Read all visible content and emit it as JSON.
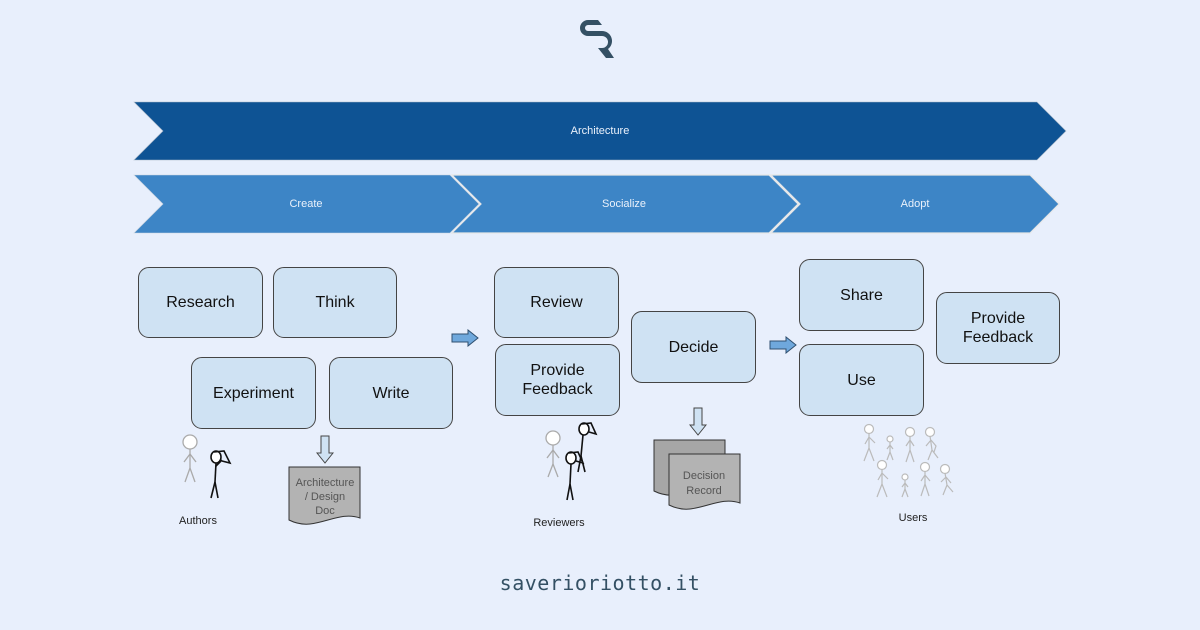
{
  "logo": {
    "icon": "sr-logo-icon",
    "color": "#345064"
  },
  "colors": {
    "background": "#e8effc",
    "architecture_bar": "#0e5394",
    "phase_bar": "#3d85c6",
    "box_fill": "#cfe2f3",
    "document_fill": "#b3b3b3",
    "arrow_fill": "#6fa8dc"
  },
  "architecture": {
    "label": "Architecture"
  },
  "phases": [
    {
      "label": "Create"
    },
    {
      "label": "Socialize"
    },
    {
      "label": "Adopt"
    }
  ],
  "create": {
    "boxes": [
      "Research",
      "Think",
      "Experiment",
      "Write"
    ],
    "actors_label": "Authors",
    "document": {
      "lines": [
        "Architecture",
        "/ Design",
        "Doc"
      ]
    }
  },
  "socialize": {
    "boxes": [
      "Review",
      "Provide\nFeedback",
      "Decide"
    ],
    "actors_label": "Reviewers",
    "document": {
      "lines": [
        "Decision",
        "Record"
      ]
    }
  },
  "adopt": {
    "boxes": [
      "Share",
      "Use",
      "Provide\nFeedback"
    ],
    "actors_label": "Users"
  },
  "footer": {
    "site": "saverioriotto.it"
  }
}
